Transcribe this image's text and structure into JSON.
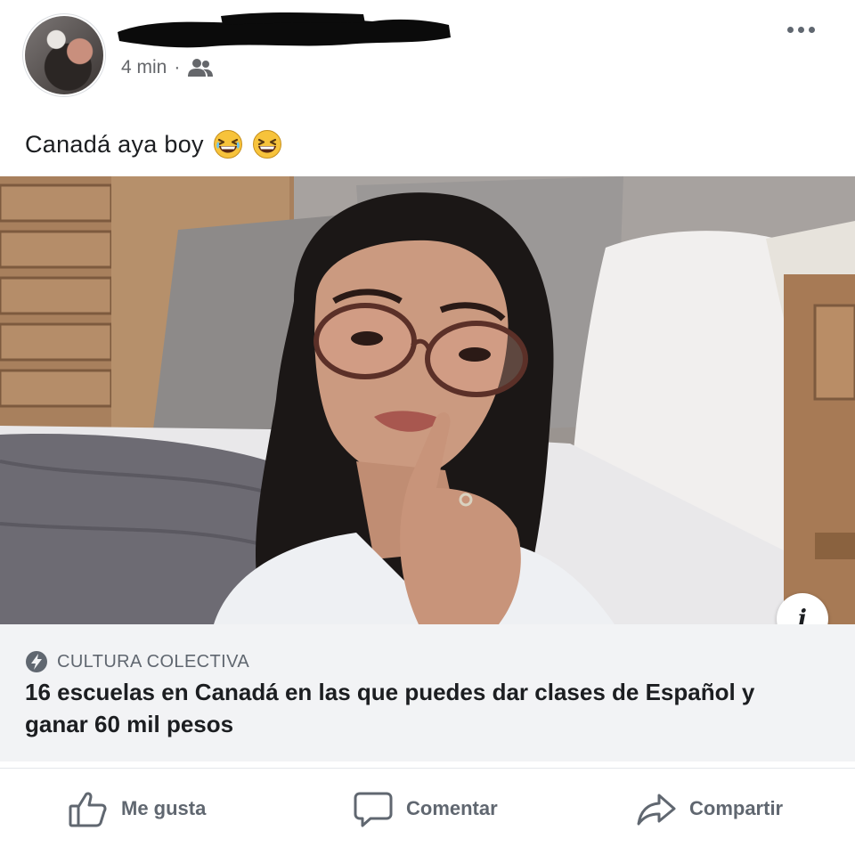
{
  "post": {
    "time": "4 min",
    "separator": "·",
    "audience_icon": "friends-icon",
    "caption": "Canadá aya boy",
    "caption_emojis": [
      "grinning-squinting-face",
      "grinning-squinting-face"
    ]
  },
  "link_preview": {
    "source_icon": "lightning-circle-icon",
    "source": "CULTURA COLECTIVA",
    "headline": "16 escuelas en Canadá en las que puedes dar clases de Español y ganar 60 mil pesos",
    "info_label": "i"
  },
  "actions": {
    "like_label": "Me gusta",
    "comment_label": "Comentar",
    "share_label": "Compartir"
  },
  "colors": {
    "text_primary": "#1c1e21",
    "text_secondary": "#65676b",
    "preview_background": "#f2f3f5"
  }
}
